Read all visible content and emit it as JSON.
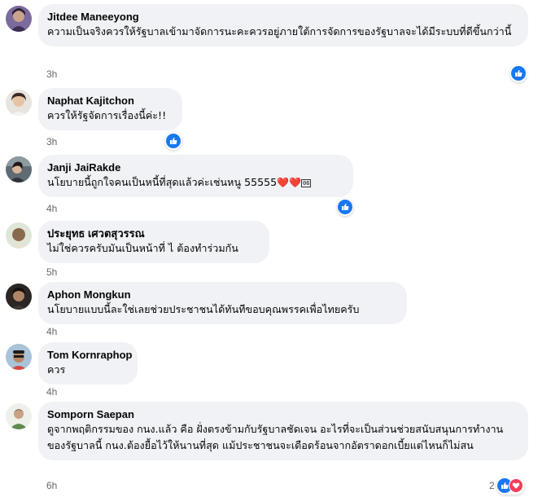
{
  "comments": [
    {
      "author": "Jitdee Maneeyong",
      "text": "ความเป็นจริงควรให้รัฐบาลเข้ามาจัดการนะคะควรอยู่ภายใต้การจัดการของรัฐบาลจะได้มีระบบที่ดีขึ้นกว่านี้",
      "time": "3h",
      "reactions": [
        "like-icon"
      ]
    },
    {
      "author": "Naphat Kajitchon",
      "text": "ควรให้รัฐจัดการเรื่องนี้ค่ะ!!",
      "time": "3h",
      "reactions": [
        "like-icon"
      ]
    },
    {
      "author": "Janji JaiRakde",
      "text": "นโยบายนี้ถูกใจคนเป็นหนี้ที่สุดแล้วค่ะเช่นหนู 55555",
      "text_emoji": "❤️❤️",
      "text_box": "06",
      "time": "4h",
      "reactions": [
        "like-icon"
      ]
    },
    {
      "author": "ประยุทธ เศวตสุวรรณ",
      "text": "ไม่ใช่ควรครับมันเป็นหน้าที่ ไ ต้องทำร่วมกัน",
      "time": "5h",
      "reactions": []
    },
    {
      "author": "Aphon Mongkun",
      "text": "นโยบายแบบนี้ละใช่เลยช่วยประชาชนได้ทันทีขอบคุณพรรคเพื่อไทยครับ",
      "time": "4h",
      "reactions": []
    },
    {
      "author": "Tom Kornraphop",
      "text": "ควร",
      "time": "4h",
      "reactions": []
    },
    {
      "author": "Somporn Saepan",
      "text": "ดูจากพฤติกรรมของ กนง.แล้ว คือ ฝั่งตรงข้ามกับรัฐบาลชัดเจน อะไรที่จะเป็นส่วนช่วยสนับสนุนการทำงานของรัฐบาลนี้ กนง.ต้องยื้อไว้ให้นานที่สุด แม้ประชาชนจะเดือดร้อนจากอัตราดอกเบี้ยแต่ไหนก็ไม่สน",
      "time": "6h",
      "reaction_count": "2",
      "reactions": [
        "like-icon",
        "love-icon"
      ]
    }
  ],
  "colors": {
    "bubble": "#f0f2f5",
    "time": "#65676b",
    "like": "#1877f2",
    "love": "#f33e58"
  }
}
